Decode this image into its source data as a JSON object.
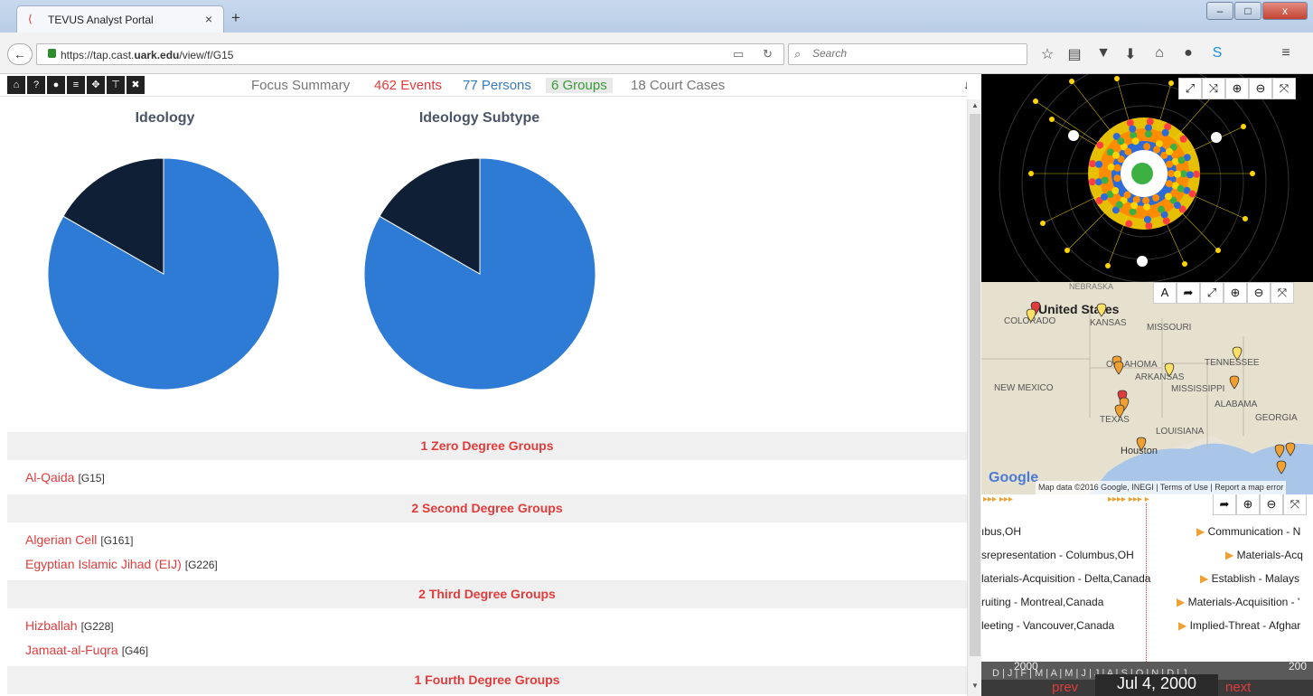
{
  "browser": {
    "tab_title": "TEVUS Analyst Portal",
    "tab_close": "×",
    "new_tab": "+",
    "url_prefix": "https://tap.cast.",
    "url_domain": "uark.edu",
    "url_path": "/view/f/G15",
    "search_placeholder": "Search",
    "window_controls": [
      "–",
      "□",
      "x"
    ]
  },
  "toolbar": {
    "tools": [
      "home-icon",
      "help-icon",
      "person-icon",
      "list-icon",
      "move-icon",
      "filter-icon",
      "close-icon"
    ],
    "tool_glyphs": [
      "⌂",
      "?",
      "●",
      "≡",
      "✥",
      "⊤",
      "✖"
    ],
    "links": [
      {
        "label": "Focus Summary",
        "color": "#777777"
      },
      {
        "label": "462 Events",
        "color": "#e03c3c"
      },
      {
        "label": "77 Persons",
        "color": "#3a7bbf"
      },
      {
        "label": "6 Groups",
        "color": "#3a9a3a",
        "active": true
      },
      {
        "label": "18 Court Cases",
        "color": "#777777"
      }
    ],
    "download": "↓"
  },
  "charts": {
    "ideology_title": "Ideology",
    "subtype_title": "Ideology Subtype"
  },
  "chart_data": [
    {
      "type": "pie",
      "title": "Ideology",
      "values": [
        83.3,
        16.7
      ],
      "colors": [
        "#2e7bd6",
        "#0f1f35"
      ]
    },
    {
      "type": "pie",
      "title": "Ideology Subtype",
      "values": [
        83.3,
        16.7
      ],
      "colors": [
        "#2e7bd6",
        "#0f1f35"
      ]
    }
  ],
  "groups": {
    "zero_header": "1 Zero Degree Groups",
    "zero": [
      {
        "name": "Al-Qaida",
        "id": "[G15]"
      }
    ],
    "second_header": "2 Second Degree Groups",
    "second": [
      {
        "name": "Algerian Cell",
        "id": "[G161]"
      },
      {
        "name": "Egyptian Islamic Jihad (EIJ)",
        "id": "[G226]"
      }
    ],
    "third_header": "2 Third Degree Groups",
    "third": [
      {
        "name": "Hizballah",
        "id": "[G228]"
      },
      {
        "name": "Jamaat-al-Fuqra",
        "id": "[G46]"
      }
    ],
    "fourth_header": "1 Fourth Degree Groups"
  },
  "map": {
    "labels": {
      "us": "United States",
      "colorado": "COLORADO",
      "kansas": "KANSAS",
      "missouri": "MISSOURI",
      "oklahoma": "OKLAHOMA",
      "arkansas": "ARKANSAS",
      "tennessee": "TENNESSEE",
      "new_mexico": "NEW MEXICO",
      "mississippi": "MISSISSIPPI",
      "alabama": "ALABAMA",
      "georgia": "GEORGIA",
      "texas": "TEXAS",
      "louisiana": "LOUISIANA",
      "houston": "Houston",
      "nebraska": "NEBRASKA"
    },
    "attribution": "Map data ©2016 Google, INEGI",
    "terms": "Terms of Use",
    "report": "Report a map error",
    "google": "Google"
  },
  "timeline": {
    "left_rows": [
      "ıbus,OH",
      "srepresentation - Columbus,OH",
      "laterials-Acquisition - Delta,Canada",
      "ruiting - Montreal,Canada",
      "leeting - Vancouver,Canada"
    ],
    "right_rows": [
      "Communication - N",
      "Materials-Acq",
      "Establish - Malays",
      "Materials-Acquisition - '",
      "Implied-Threat - Afghar"
    ],
    "year_left": "2000",
    "year_right": "200",
    "months": "D | J | F | M | A | M | J | J | A | S | O | N | D | J",
    "prev": "prev",
    "next": "next",
    "current_date": "Jul 4, 2000"
  }
}
